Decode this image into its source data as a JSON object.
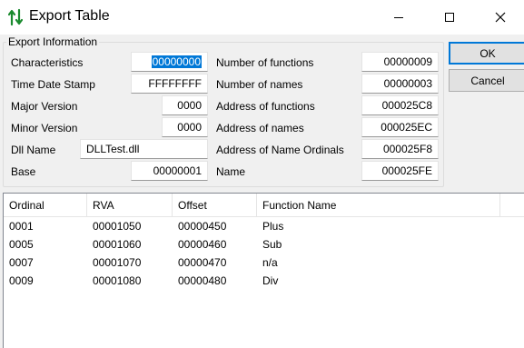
{
  "window": {
    "title": "Export Table"
  },
  "export_info": {
    "group_label": "Export Information",
    "left_fields": [
      {
        "label": "Characteristics",
        "value": "00000000"
      },
      {
        "label": "Time Date Stamp",
        "value": "FFFFFFFF"
      },
      {
        "label": "Major Version",
        "value": "0000"
      },
      {
        "label": "Minor Version",
        "value": "0000"
      },
      {
        "label": "Dll Name",
        "value": "DLLTest.dll"
      },
      {
        "label": "Base",
        "value": "00000001"
      }
    ],
    "right_fields": [
      {
        "label": "Number of functions",
        "value": "00000009"
      },
      {
        "label": "Number of names",
        "value": "00000003"
      },
      {
        "label": "Address of functions",
        "value": "000025C8"
      },
      {
        "label": "Address of names",
        "value": "000025EC"
      },
      {
        "label": "Address of Name Ordinals",
        "value": "000025F8"
      },
      {
        "label": "Name",
        "value": "000025FE"
      }
    ]
  },
  "buttons": {
    "ok": "OK",
    "cancel": "Cancel"
  },
  "table": {
    "columns": [
      "Ordinal",
      "RVA",
      "Offset",
      "Function Name"
    ],
    "rows": [
      [
        "0001",
        "00001050",
        "00000450",
        "Plus"
      ],
      [
        "0005",
        "00001060",
        "00000460",
        "Sub"
      ],
      [
        "0007",
        "00001070",
        "00000470",
        "n/a"
      ],
      [
        "0009",
        "00001080",
        "00000480",
        "Div"
      ]
    ]
  },
  "colors": {
    "selection": "#0078d7",
    "window_bg": "#f0f0f0"
  }
}
